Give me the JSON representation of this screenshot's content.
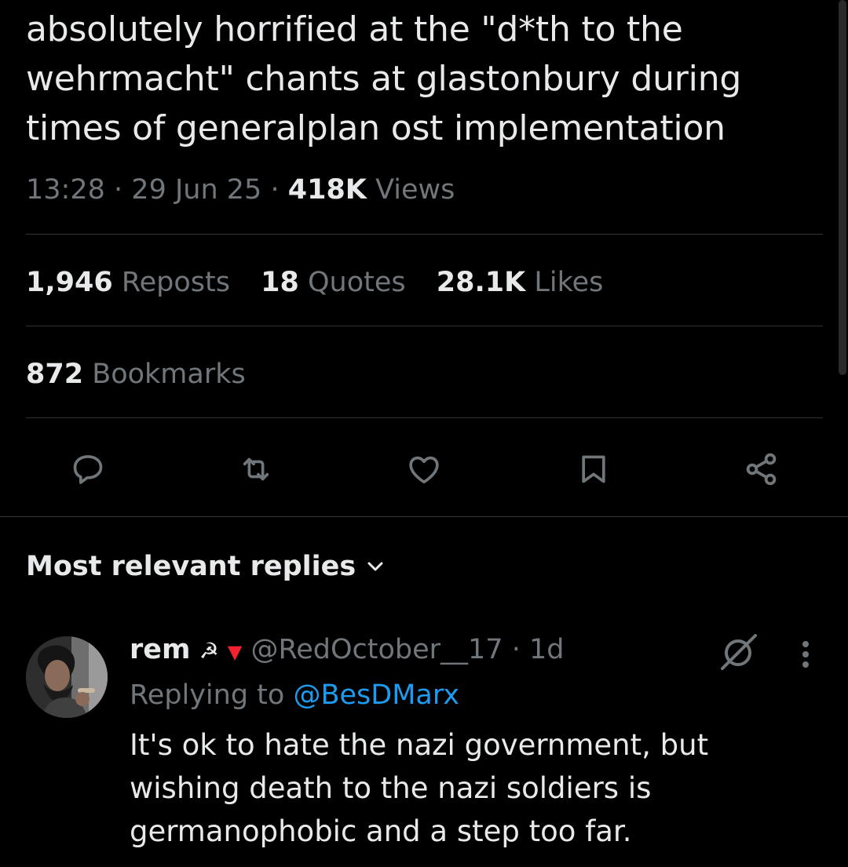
{
  "tweet": {
    "text": "absolutely horrified at the \"d*th to the wehrmacht\" chants at glastonbury during times of generalplan ost implementation",
    "time": "13:28",
    "date": "29 Jun 25",
    "views_count": "418K",
    "views_label": "Views",
    "separator": "·"
  },
  "stats": {
    "reposts_count": "1,946",
    "reposts_label": "Reposts",
    "quotes_count": "18",
    "quotes_label": "Quotes",
    "likes_count": "28.1K",
    "likes_label": "Likes",
    "bookmarks_count": "872",
    "bookmarks_label": "Bookmarks"
  },
  "actions": {
    "icons": [
      "reply-icon",
      "repost-icon",
      "like-icon",
      "bookmark-icon",
      "share-icon"
    ],
    "icon_color": "#71767b"
  },
  "replies": {
    "header": "Most relevant replies",
    "items": [
      {
        "name": "rem",
        "flair": "☭",
        "flair_triangle": "▼",
        "handle": "@RedOctober__17",
        "age": "1d",
        "replying_prefix": "Replying to",
        "replying_to": "@BesDMarx",
        "text": "It's ok to hate the nazi government, but wishing death to the nazi soldiers is germanophobic and a step too far."
      }
    ]
  },
  "colors": {
    "background": "#000000",
    "text_primary": "#e7e9ea",
    "text_secondary": "#71767b",
    "link": "#1d9bf0",
    "divider": "#2f3336",
    "flair_red": "#f4212e"
  }
}
